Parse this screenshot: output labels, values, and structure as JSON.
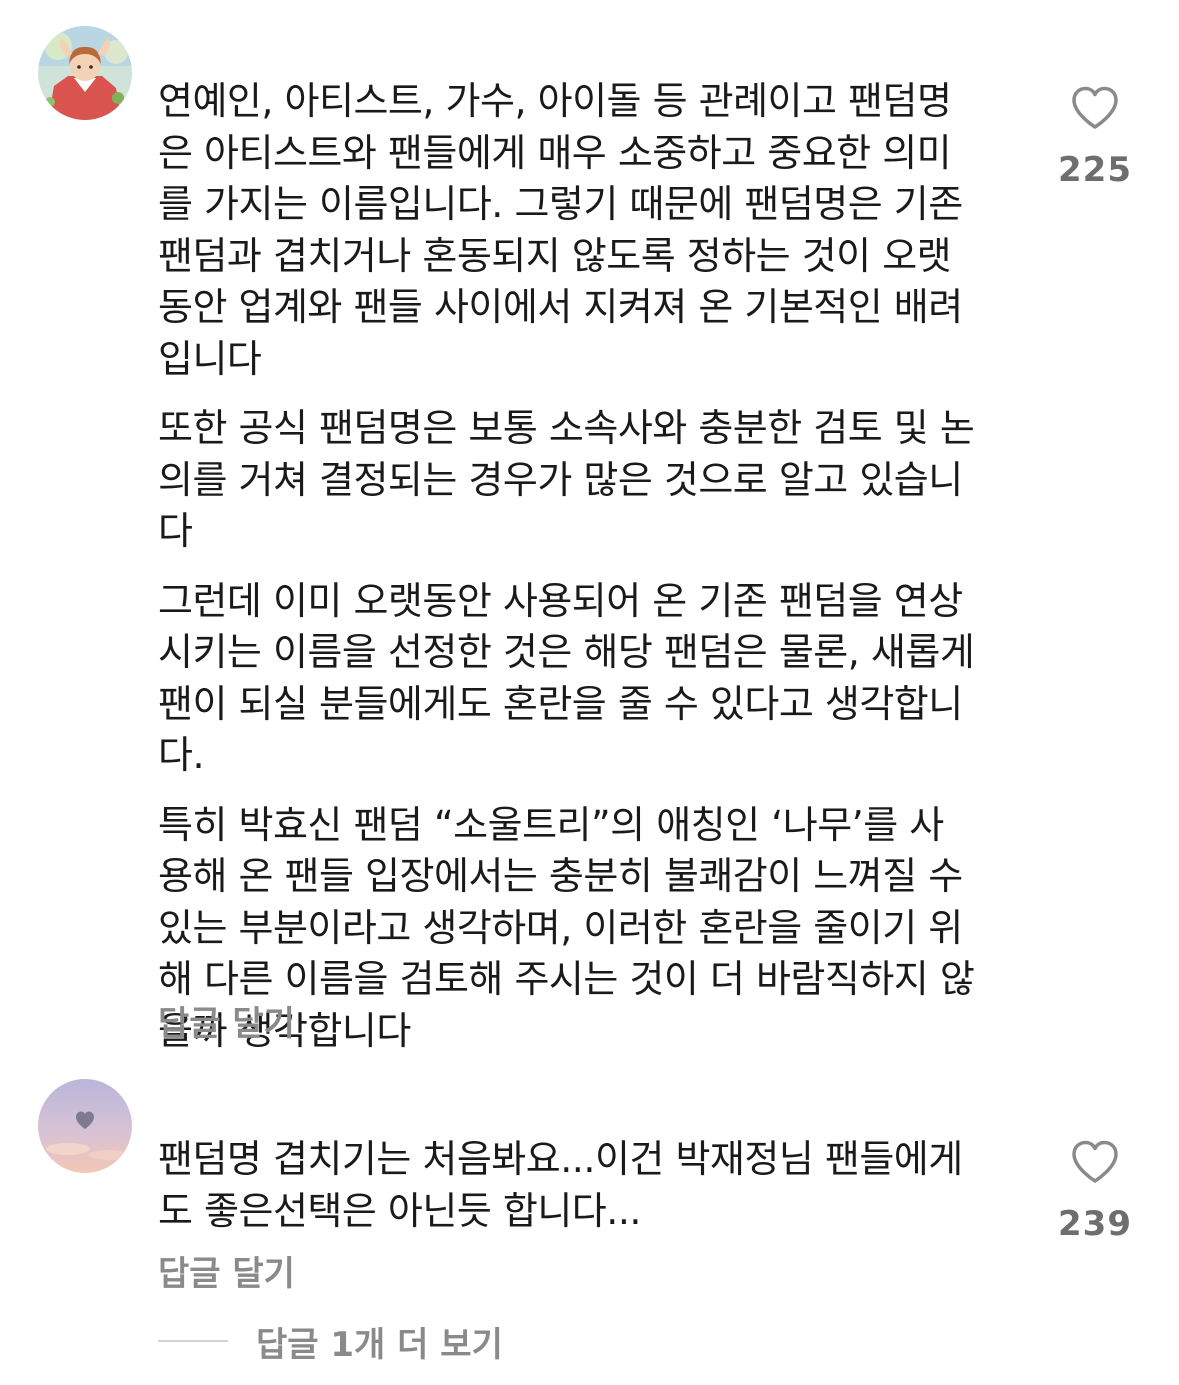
{
  "comments": [
    {
      "avatar": "anime-girl-avatar",
      "paragraphs": [
        "연예인, 아티스트, 가수, 아이돌 등 관례이고 팬덤명\n은 아티스트와 팬들에게 매우 소중하고 중요한 의미\n를 가지는 이름입니다. 그렇기 때문에 팬덤명은 기존\n팬덤과 겹치거나 혼동되지 않도록 정하는 것이 오랫\n동안 업계와 팬들 사이에서 지켜져 온 기본적인 배려\n입니다",
        "또한 공식 팬덤명은 보통 소속사와 충분한 검토 및 논\n의를 거쳐 결정되는 경우가 많은 것으로 알고 있습니\n다",
        "그런데 이미 오랫동안 사용되어 온 기존 팬덤을 연상\n시키는 이름을 선정한 것은 해당 팬덤은 물론, 새롭게\n팬이 되실 분들에게도 혼란을 줄 수 있다고 생각합니\n다.",
        "특히 박효신 팬덤 “소울트리”의 애칭인 ‘나무’를 사\n용해 온 팬들 입장에서는 충분히 불쾌감이 느껴질 수\n있는 부분이라고 생각하며, 이러한 혼란을 줄이기 위\n해 다른 이름을 검토해 주시는 것이 더 바람직하지 않\n을까 생각합니다"
      ],
      "like_icon": "heart-outline-icon",
      "likes": "225",
      "reply_label": "답글 달기"
    },
    {
      "avatar": "sky-heart-cloud-avatar",
      "paragraphs": [
        "팬덤명 겹치기는 처음봐요...이건 박재정님 팬들에게\n도 좋은선택은 아닌듯 합니다..."
      ],
      "like_icon": "heart-outline-icon",
      "likes": "239",
      "reply_label": "답글 달기"
    }
  ],
  "more_replies_label": "답글 1개 더 보기"
}
